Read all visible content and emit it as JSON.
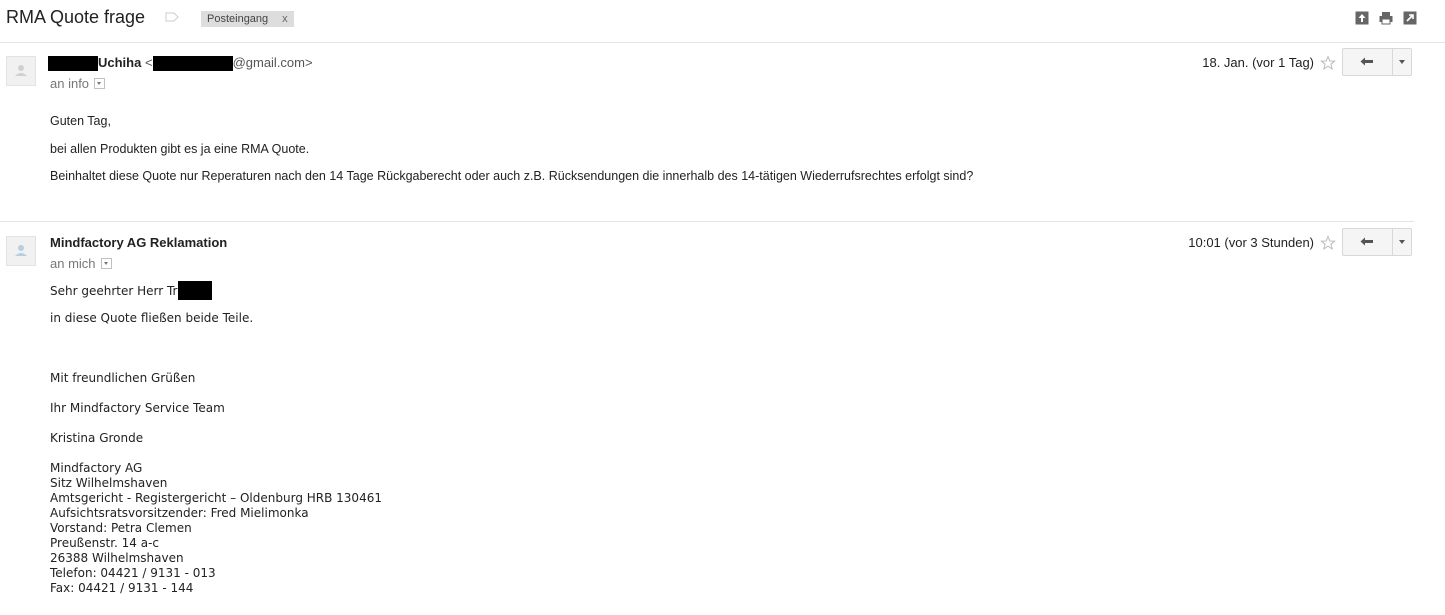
{
  "thread": {
    "subject": "RMA Quote frage",
    "label_chip": "Posteingang",
    "label_chip_remove": "x",
    "actions": {
      "expand_icon": "expand-all-icon",
      "print_icon": "print-icon",
      "popout_icon": "new-window-icon"
    }
  },
  "messages": [
    {
      "sender_name": "Uchiha",
      "sender_email_domain": "@gmail.com>",
      "sender_email_open": "<",
      "recipient": "an info",
      "date": "18. Jan. (vor 1 Tag)",
      "body": [
        "Guten Tag,",
        "bei allen Produkten gibt es ja eine RMA Quote.",
        "Beinhaltet diese Quote nur Reperaturen nach den 14 Tage Rückgaberecht oder auch z.B. Rücksendungen die innerhalb des 14-tätigen Wiederrufsrechtes erfolgt sind?"
      ]
    },
    {
      "sender_name": "Mindfactory AG Reklamation",
      "recipient": "an mich",
      "date": "10:01 (vor 3 Stunden)",
      "greeting": "Sehr geehrter Herr Tr",
      "body": [
        "in diese Quote fließen beide Teile.",
        "Mit freundlichen Grüßen",
        "Ihr Mindfactory Service Team",
        "Kristina Gronde"
      ],
      "signature": [
        "Mindfactory AG",
        "Sitz Wilhelmshaven",
        "Amtsgericht - Registergericht – Oldenburg HRB 130461",
        "Aufsichtsratsvorsitzender: Fred Mielimonka",
        "Vorstand: Petra Clemen",
        "Preußenstr. 14 a-c",
        "26388 Wilhelmshaven",
        "Telefon: 04421 / 9131 - 013",
        "Fax: 04421 / 9131 - 144"
      ]
    }
  ],
  "colors": {
    "redaction": "#000000",
    "chip_bg": "#dddddd",
    "divider": "#e5e5e5"
  }
}
